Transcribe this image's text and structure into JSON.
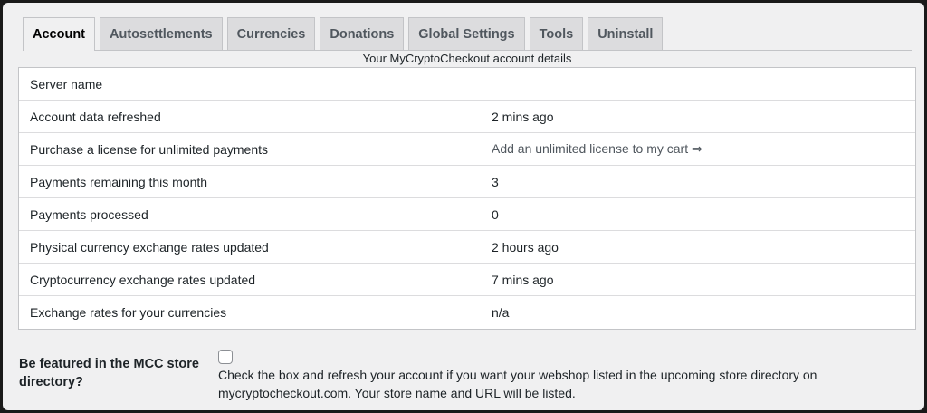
{
  "tabs": [
    {
      "label": "Account",
      "active": true
    },
    {
      "label": "Autosettlements"
    },
    {
      "label": "Currencies"
    },
    {
      "label": "Donations"
    },
    {
      "label": "Global Settings"
    },
    {
      "label": "Tools"
    },
    {
      "label": "Uninstall"
    }
  ],
  "caption": "Your MyCryptoCheckout account details",
  "rows": [
    {
      "label": "Server name",
      "value": ""
    },
    {
      "label": "Account data refreshed",
      "value": "2 mins ago"
    },
    {
      "label": "Purchase a license for unlimited payments",
      "value": "Add an unlimited license to my cart ⇒"
    },
    {
      "label": "Payments remaining this month",
      "value": "3"
    },
    {
      "label": "Payments processed",
      "value": "0"
    },
    {
      "label": "Physical currency exchange rates updated",
      "value": "2 hours ago"
    },
    {
      "label": "Cryptocurrency exchange rates updated",
      "value": "7 mins ago"
    },
    {
      "label": "Exchange rates for your currencies",
      "value": "n/a"
    }
  ],
  "featured": {
    "label": "Be featured in the MCC store directory?",
    "checked": false,
    "description": "Check the box and refresh your account if you want your webshop listed in the upcoming store directory on mycryptocheckout.com. Your store name and URL will be listed."
  }
}
